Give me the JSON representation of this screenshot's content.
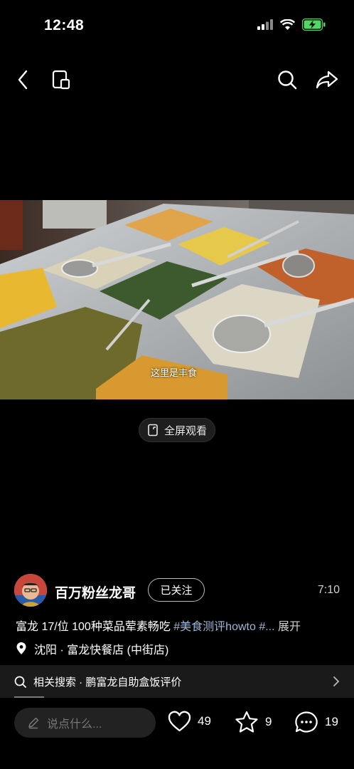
{
  "status_bar": {
    "time": "12:48"
  },
  "video": {
    "subtitle": "这里是丰食"
  },
  "fullscreen": {
    "label": "全屏观看"
  },
  "author": {
    "name": "百万粉丝龙哥",
    "follow_label": "已关注",
    "duration": "7:10"
  },
  "description": {
    "text": "富龙 17/位 100种菜品荤素畅吃 ",
    "tags": "#美食测评howto #...",
    "more": "展开"
  },
  "location": {
    "text": "沈阳 · 富龙快餐店 (中街店)"
  },
  "related": {
    "label": "相关搜索 · 鹏富龙自助盒饭评价"
  },
  "bottom": {
    "comment_placeholder": "说点什么...",
    "likes": "49",
    "favorites": "9",
    "comments": "19"
  },
  "colors": {
    "background": "#000000",
    "tag": "#9fb6d6",
    "battery": "#4cd964"
  }
}
